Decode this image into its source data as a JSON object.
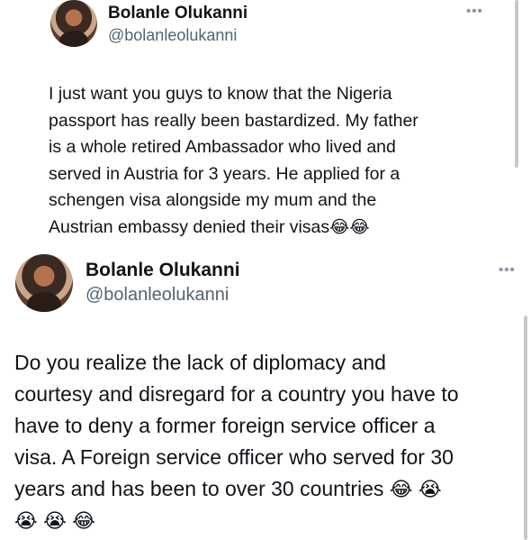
{
  "tweets": [
    {
      "author": {
        "name": "Bolanle Olukanni",
        "handle": "@bolanleolukanni"
      },
      "more_icon": "more-icon",
      "text": "I just want you guys to know that the Nigeria\npassport has really been bastardized. My father\nis a whole retired Ambassador who lived and\nserved in Austria for 3 years. He applied for a\nschengen visa alongside my mum and the\nAustrian embassy denied their visas",
      "emojis": [
        "😂",
        "😂"
      ]
    },
    {
      "author": {
        "name": "Bolanle Olukanni",
        "handle": "@bolanleolukanni"
      },
      "more_icon": "more-icon",
      "text": "Do you realize the lack of diplomacy and\ncourtesy and disregard for a country you have to\nhave to deny a former foreign service officer a\nvisa. A Foreign service officer who served for 30\nyears and has been to over 30 countries ",
      "emojis": [
        "😂",
        "😭"
      ],
      "emojis_line2": [
        "😭",
        "😭",
        "😂"
      ]
    }
  ],
  "more_glyph": "•••"
}
